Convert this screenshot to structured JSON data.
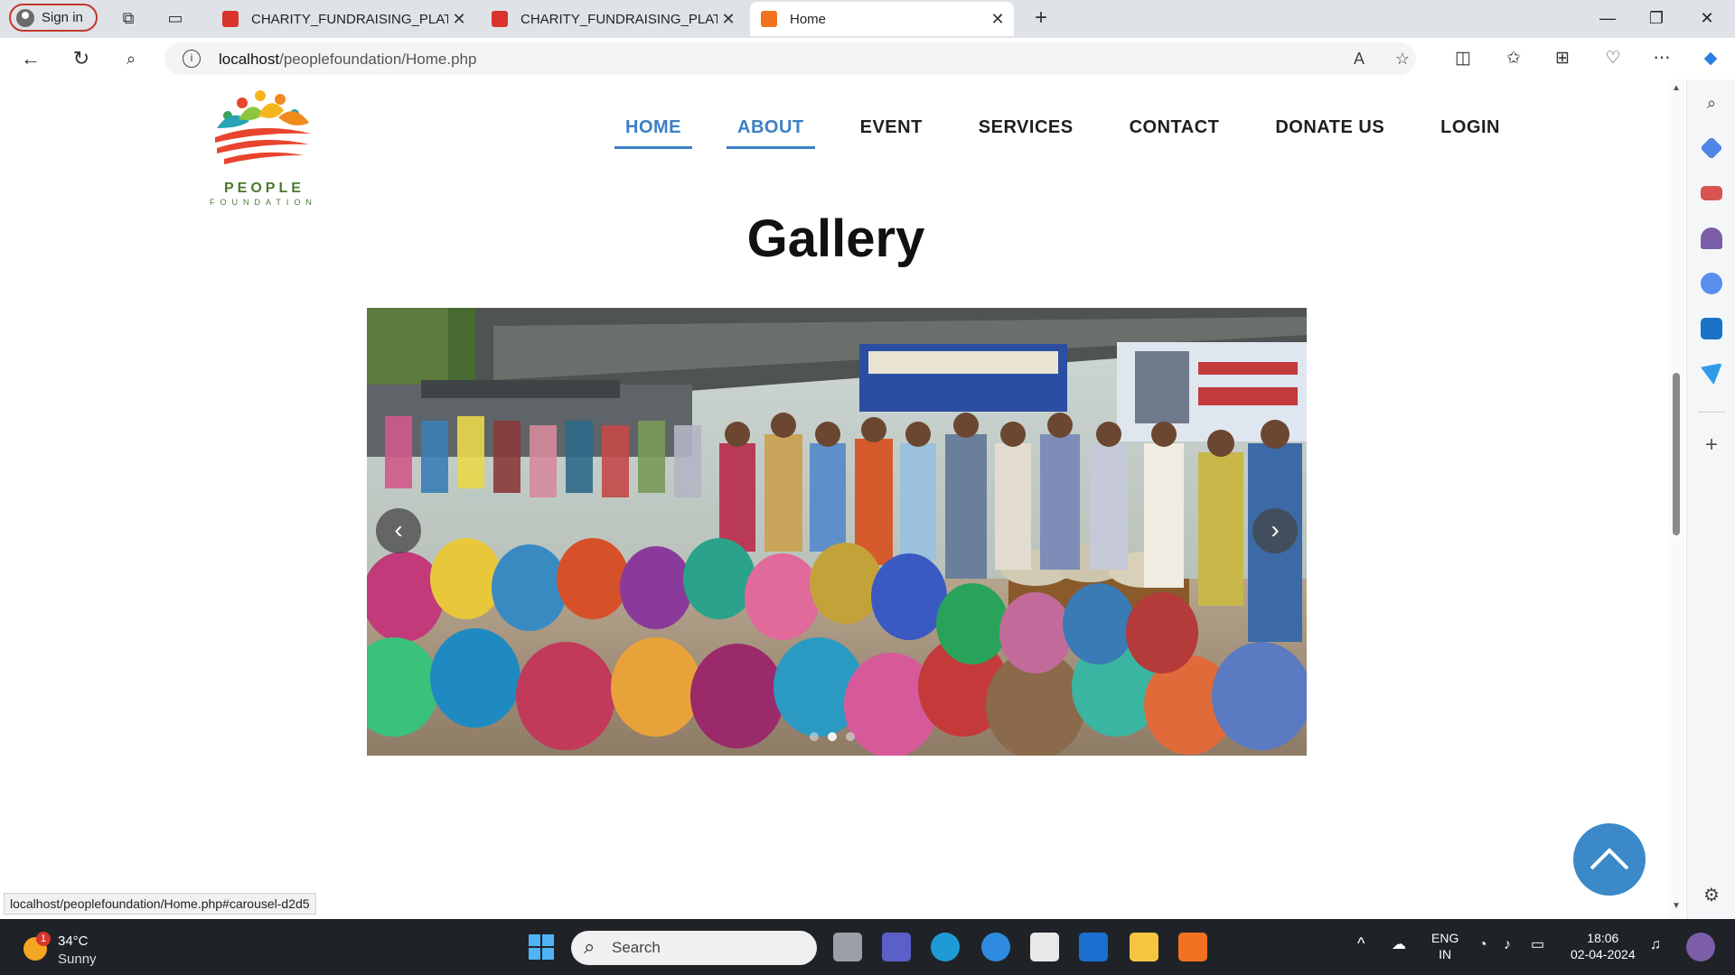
{
  "browser": {
    "signin_label": "Sign in",
    "tabs": [
      {
        "title": "CHARITY_FUNDRAISING_PLATFO",
        "icon": "pdf-icon",
        "active": false
      },
      {
        "title": "CHARITY_FUNDRAISING_PLATFO",
        "icon": "pdf-icon",
        "active": false
      },
      {
        "title": "Home",
        "icon": "xampp-icon",
        "active": true
      }
    ],
    "url_host": "localhost",
    "url_path": "/peoplefoundation/Home.php",
    "status_url": "localhost/peoplefoundation/Home.php#carousel-d2d5"
  },
  "site": {
    "logo_line1": "PEOPLE",
    "logo_line2": "FOUNDATION",
    "nav": [
      {
        "label": "HOME",
        "active": true
      },
      {
        "label": "ABOUT",
        "active": true
      },
      {
        "label": "EVENT",
        "active": false
      },
      {
        "label": "SERVICES",
        "active": false
      },
      {
        "label": "CONTACT",
        "active": false
      },
      {
        "label": "DONATE US",
        "active": false
      },
      {
        "label": "LOGIN",
        "active": false
      }
    ],
    "gallery_title": "Gallery",
    "carousel": {
      "slides": 3,
      "active_slide": 2
    },
    "accent_color": "#3b7fc4"
  },
  "taskbar": {
    "weather_temp": "34°C",
    "weather_condition": "Sunny",
    "weather_badge": "1",
    "search_placeholder": "Search",
    "lang_line1": "ENG",
    "lang_line2": "IN",
    "time": "18:06",
    "date": "02-04-2024"
  }
}
